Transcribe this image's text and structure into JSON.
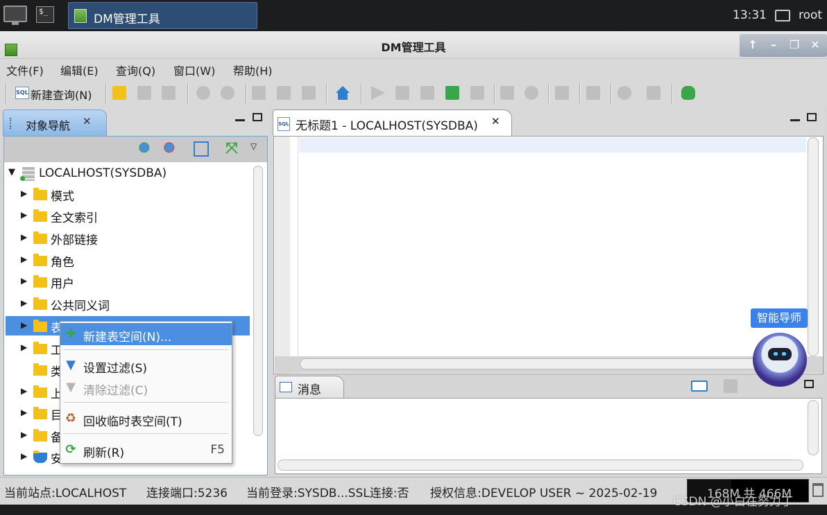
{
  "taskbar": {
    "task_label": "DM管理工具",
    "time": "13:31",
    "user": "root",
    "terminal_label": "$_"
  },
  "window": {
    "title": "DM管理工具"
  },
  "menu": {
    "items": [
      "文件(F)",
      "编辑(E)",
      "查询(Q)",
      "窗口(W)",
      "帮助(H)"
    ]
  },
  "toolbar": {
    "new_query_label": "新建查询(N)",
    "sql_badge": "SQL"
  },
  "navigator": {
    "tab_label": "对象导航",
    "root_label": "LOCALHOST(SYSDBA)",
    "items": [
      {
        "label": "模式"
      },
      {
        "label": "全文索引"
      },
      {
        "label": "外部链接"
      },
      {
        "label": "角色"
      },
      {
        "label": "用户"
      },
      {
        "label": "公共同义词"
      },
      {
        "label": "表"
      },
      {
        "label": "工"
      },
      {
        "label": "类"
      },
      {
        "label": "上"
      },
      {
        "label": "目"
      },
      {
        "label": "备"
      },
      {
        "label": "安"
      }
    ]
  },
  "context_menu": {
    "items": [
      {
        "label": "新建表空间(N)...",
        "shortcut": ""
      },
      {
        "label": "设置过滤(S)",
        "shortcut": ""
      },
      {
        "label": "清除过滤(C)",
        "shortcut": ""
      },
      {
        "label": "回收临时表空间(T)",
        "shortcut": ""
      },
      {
        "label": "刷新(R)",
        "shortcut": "F5"
      }
    ]
  },
  "editor": {
    "tab_label": "无标题1 - LOCALHOST(SYSDBA)"
  },
  "messages": {
    "tab_label": "消息"
  },
  "guide": {
    "label": "智能导师"
  },
  "statusbar": {
    "site": "当前站点:LOCALHOST",
    "port": "连接端口:5236",
    "login": "当前登录:SYSDB...SSL连接:否",
    "license": "授权信息:DEVELOP USER ~ 2025-02-19",
    "memory": "168M 共 466M",
    "memory_used_fraction": 0.36
  },
  "watermark": "CSDN @小白在努力丁",
  "colors": {
    "selection": "#4b8fe0",
    "folder": "#f3c21a",
    "guide": "#3b82e8"
  }
}
